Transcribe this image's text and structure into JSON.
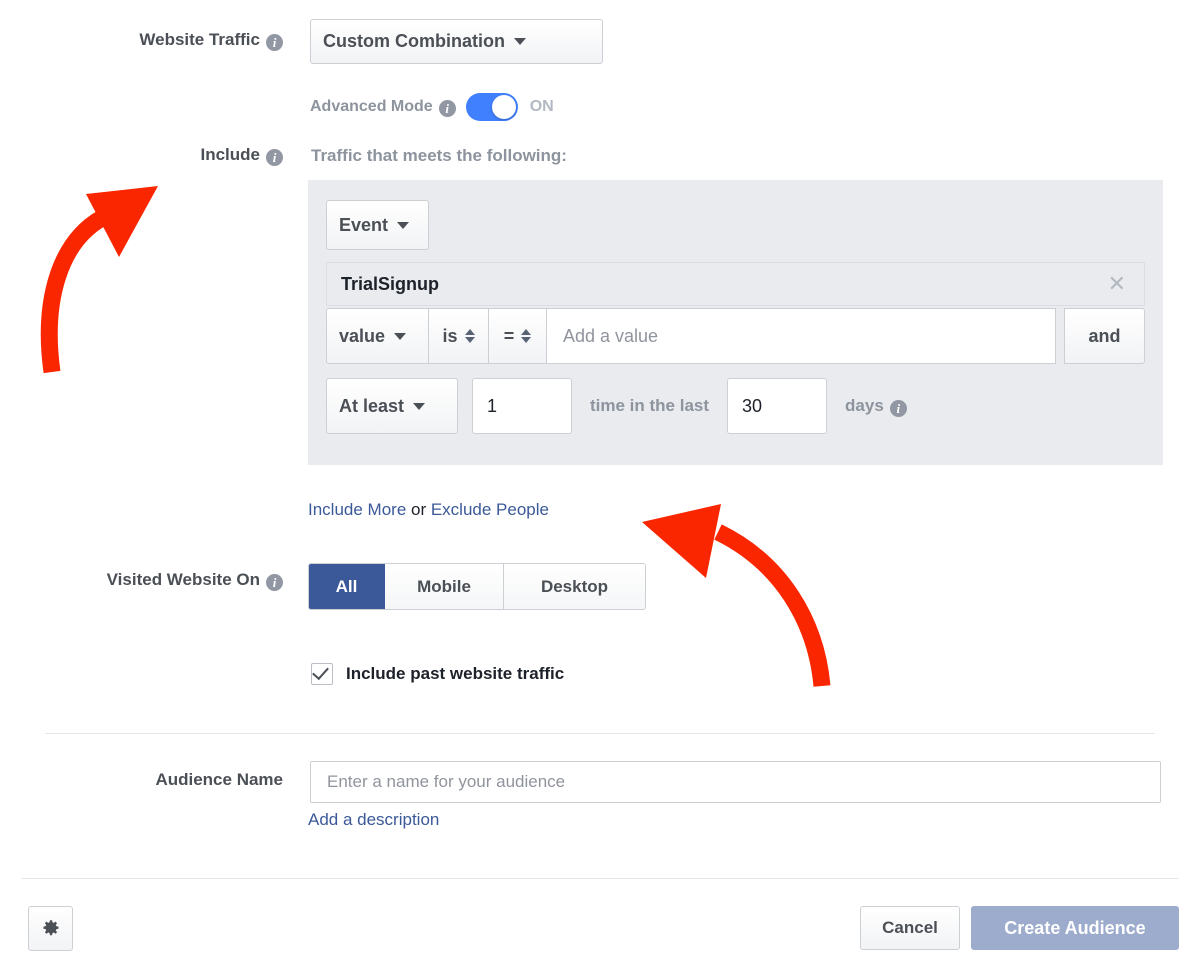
{
  "colors": {
    "link": "#3b5998",
    "accent_toggle": "#4080ff",
    "segment_active": "#3b5998",
    "primary_button": "#9daccd",
    "annotation": "#fa2600",
    "panel": "#e9ebee"
  },
  "website_traffic": {
    "label": "Website Traffic",
    "info_icon": "info-icon",
    "selected_option": "Custom Combination",
    "caret_icon": "chevron-down-icon"
  },
  "advanced_mode": {
    "label": "Advanced Mode",
    "info_icon": "info-icon",
    "state": "ON",
    "enabled": true
  },
  "include": {
    "label": "Include",
    "info_icon": "info-icon",
    "description": "Traffic that meets the following:"
  },
  "condition": {
    "event_type_button": "Event",
    "event_type_caret": "chevron-down-icon",
    "event_name": "TrialSignup",
    "remove_icon": "close-icon",
    "value_field": "value",
    "value_field_caret": "chevron-down-icon",
    "operator_is": "is",
    "operator_is_stepper": "updown-stepper-icon",
    "operator_eq": "=",
    "operator_eq_stepper": "updown-stepper-icon",
    "value_input_value": "",
    "value_input_placeholder": "Add a value",
    "and_button": "and",
    "frequency_operator": "At least",
    "frequency_operator_caret": "chevron-down-icon",
    "frequency_count": "1",
    "frequency_middle_text": "time in the last",
    "frequency_days": "30",
    "frequency_days_unit": "days",
    "frequency_info_icon": "info-icon"
  },
  "include_more": {
    "include_more_link": "Include More",
    "separator": " or ",
    "exclude_people_link": "Exclude People"
  },
  "visited_website_on": {
    "label": "Visited Website On",
    "info_icon": "info-icon",
    "options": [
      "All",
      "Mobile",
      "Desktop"
    ],
    "selected": "All"
  },
  "past_traffic": {
    "label": "Include past website traffic",
    "checked": true,
    "check_icon": "checkmark-icon"
  },
  "audience_name": {
    "label": "Audience Name",
    "value": "",
    "placeholder": "Enter a name for your audience",
    "add_description_link": "Add a description"
  },
  "footer": {
    "settings_icon": "gear-icon",
    "cancel_label": "Cancel",
    "create_label": "Create Audience"
  },
  "annotations": [
    {
      "name": "arrow-pointing-to-include",
      "direction": "up-right",
      "color": "#fa2600"
    },
    {
      "name": "arrow-pointing-to-exclude-people",
      "direction": "up-left",
      "color": "#fa2600"
    }
  ]
}
